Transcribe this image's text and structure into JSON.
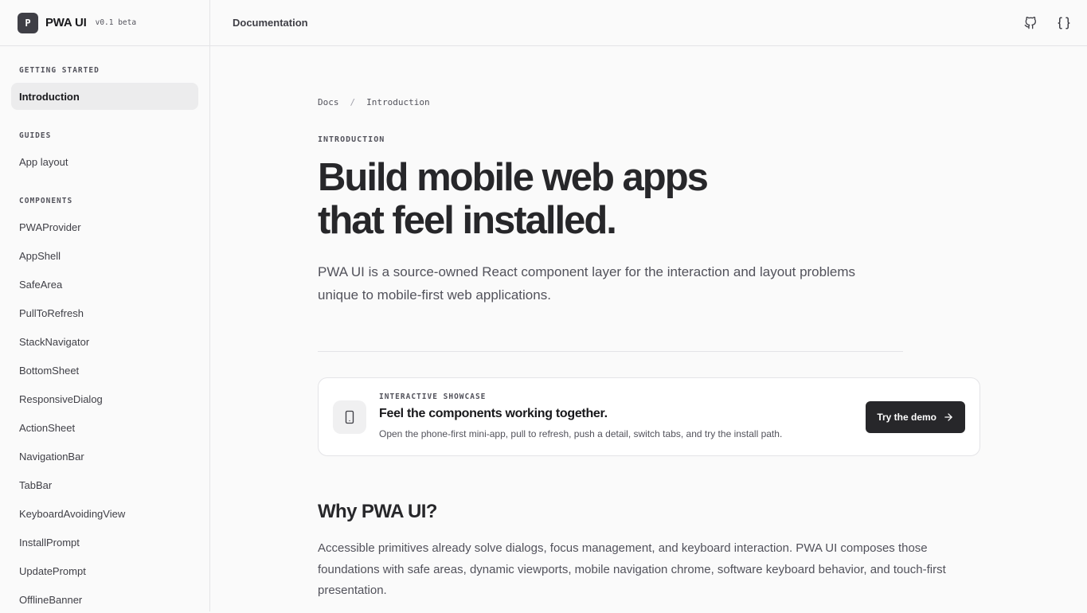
{
  "brand": {
    "logo_letter": "P",
    "name": "PWA UI",
    "version": "v0.1 beta"
  },
  "sidebar": {
    "sections": [
      {
        "label": "GETTING STARTED",
        "items": [
          "Introduction"
        ]
      },
      {
        "label": "GUIDES",
        "items": [
          "App layout"
        ]
      },
      {
        "label": "COMPONENTS",
        "items": [
          "PWAProvider",
          "AppShell",
          "SafeArea",
          "PullToRefresh",
          "StackNavigator",
          "BottomSheet",
          "ResponsiveDialog",
          "ActionSheet",
          "NavigationBar",
          "TabBar",
          "KeyboardAvoidingView",
          "InstallPrompt",
          "UpdatePrompt",
          "OfflineBanner"
        ]
      }
    ],
    "active_item": "Introduction"
  },
  "topbar": {
    "title": "Documentation",
    "icons": [
      "github-icon",
      "braces-icon"
    ]
  },
  "breadcrumb": {
    "root": "Docs",
    "separator": "/",
    "current": "Introduction"
  },
  "hero": {
    "eyebrow": "INTRODUCTION",
    "title_line1": "Build mobile web apps",
    "title_line2": "that feel installed.",
    "lede": "PWA UI is a source-owned React component layer for the interaction and layout problems unique to mobile-first web applications."
  },
  "showcase": {
    "icon": "smartphone-icon",
    "eyebrow": "INTERACTIVE SHOWCASE",
    "title": "Feel the components working together.",
    "description": "Open the phone-first mini-app, pull to refresh, push a detail, switch tabs, and try the install path.",
    "button_label": "Try the demo"
  },
  "why": {
    "heading": "Why PWA UI?",
    "body": "Accessible primitives already solve dialogs, focus management, and keyboard interaction. PWA UI composes those foundations with safe areas, dynamic viewports, mobile navigation chrome, software keyboard behavior, and touch-first presentation."
  }
}
